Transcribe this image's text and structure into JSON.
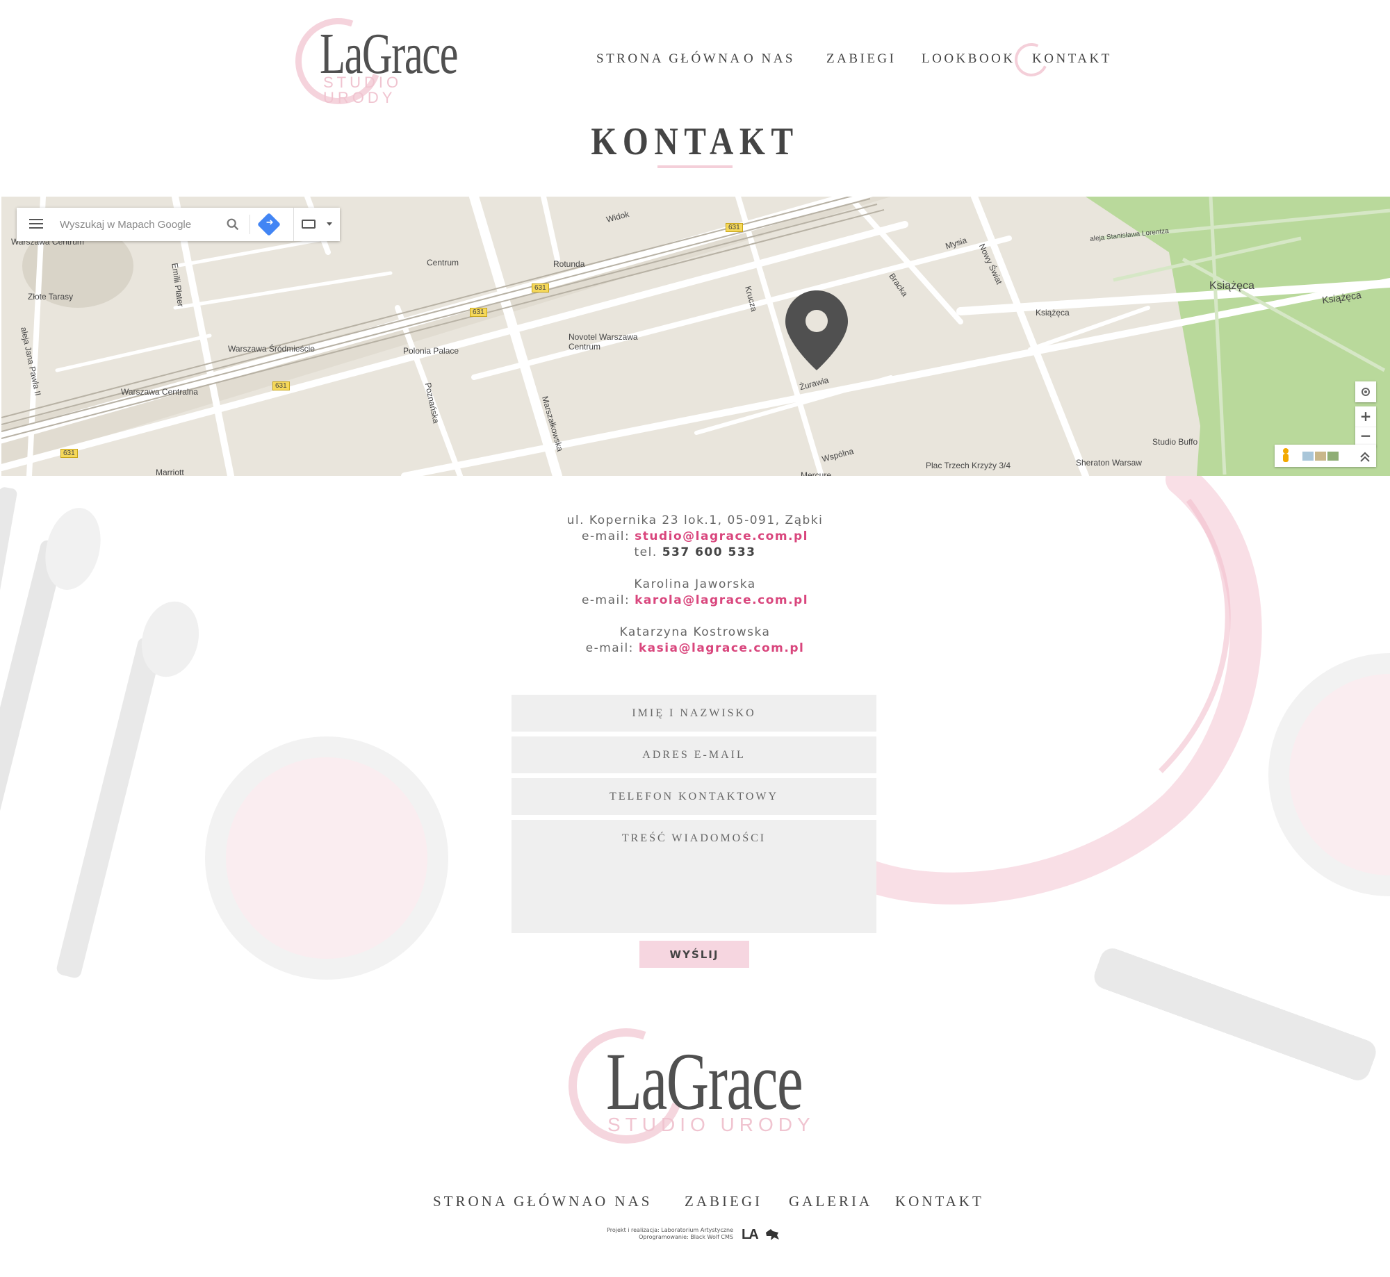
{
  "header": {
    "logo": {
      "name": "LaGrace",
      "tagline": "STUDIO URODY"
    },
    "nav": [
      {
        "label": "STRONA GŁÓWNA"
      },
      {
        "label": "O NAS"
      },
      {
        "label": "ZABIEGI"
      },
      {
        "label": "LOOKBOOK"
      },
      {
        "label": "KONTAKT",
        "active": true
      }
    ]
  },
  "page": {
    "title": "KONTAKT"
  },
  "map": {
    "search_placeholder": "Wyszukaj w Mapach Google",
    "labels": [
      "Warszawa Centrum",
      "Złote Tarasy",
      "Emilii Plater",
      "aleja Jana Pawła II",
      "Warszawa Centralna",
      "Warszawa Śródmieście",
      "Centrum",
      "Rotunda",
      "Widok",
      "631",
      "Polonia Palace",
      "Novotel Warszawa Centrum",
      "Poznańska",
      "Marszałkowska",
      "Żurawia",
      "Krucza",
      "Bracka",
      "Mysia",
      "Nowy Świat",
      "Książęca",
      "Wspólna",
      "Plac Trzech Krzyży 3/4",
      "Sheraton Warsaw",
      "Studio Buffo",
      "aleja Stanisława Lorentza",
      "Marriott",
      "Mercure"
    ],
    "zoom_in": "+",
    "zoom_out": "−",
    "colors": {
      "land": "#e9e5dc",
      "road": "#ffffff",
      "park": "#b9d99b",
      "pin": "#505050",
      "rail": "#bdb8ac"
    }
  },
  "contact": {
    "address": "ul. Kopernika 23 lok.1, 05-091, Ząbki",
    "email_label": "e-mail:",
    "email": "studio@lagrace.com.pl",
    "phone_label": "tel.",
    "phone": "537 600 533",
    "people": [
      {
        "name": "Karolina Jaworska",
        "email_label": "e-mail:",
        "email": "karola@lagrace.com.pl"
      },
      {
        "name": "Katarzyna Kostrowska",
        "email_label": "e-mail:",
        "email": "kasia@lagrace.com.pl"
      }
    ]
  },
  "form": {
    "name_placeholder": "IMIĘ I NAZWISKO",
    "email_placeholder": "ADRES E-MAIL",
    "phone_placeholder": "TELEFON KONTAKTOWY",
    "message_placeholder": "TREŚĆ WIADOMOŚCI",
    "submit_label": "WYŚLIJ"
  },
  "footer": {
    "logo": {
      "name": "LaGrace",
      "tagline": "STUDIO URODY"
    },
    "nav": [
      {
        "label": "STRONA GŁÓWNA"
      },
      {
        "label": "O NAS"
      },
      {
        "label": "ZABIEGI"
      },
      {
        "label": "GALERIA"
      },
      {
        "label": "KONTAKT"
      }
    ],
    "credits": {
      "line1": "Projekt i realizacja: Laboratorium Artystyczne",
      "line2": "Oprogramowanie: Black Wolf CMS",
      "la_logo": "LA"
    }
  },
  "theme": {
    "accent": "#d9467d",
    "pink": "#f4cfd9",
    "text": "#444444",
    "field_bg": "#efefef"
  }
}
